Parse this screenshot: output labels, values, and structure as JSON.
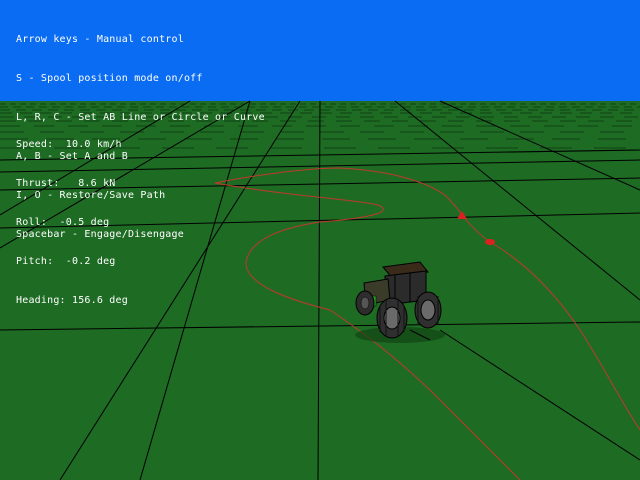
{
  "help_lines": [
    "Arrow keys - Manual control",
    "S - Spool position mode on/off",
    "L, R, C - Set AB Line or Circle or Curve",
    "A, B - Set A and B",
    "I, O - Restore/Save Path",
    "Spacebar - Engage/Disengage"
  ],
  "telemetry": {
    "speed": "Speed:  10.0 km/h",
    "thrust": "Thrust:   8.6 kN",
    "roll": "Roll:  -0.5 deg",
    "pitch": "Pitch:  -0.2 deg",
    "heading": "Heading: 156.6 deg"
  },
  "colors": {
    "sky": "#0a6cf2",
    "ground": "#1e6b24",
    "grid": "#000000",
    "path": "#c0392b",
    "marker": "#e02020",
    "text": "#ffffff"
  },
  "icons": {
    "vehicle": "tractor-icon",
    "point_a": "marker-a-icon",
    "point_b": "marker-b-icon"
  }
}
